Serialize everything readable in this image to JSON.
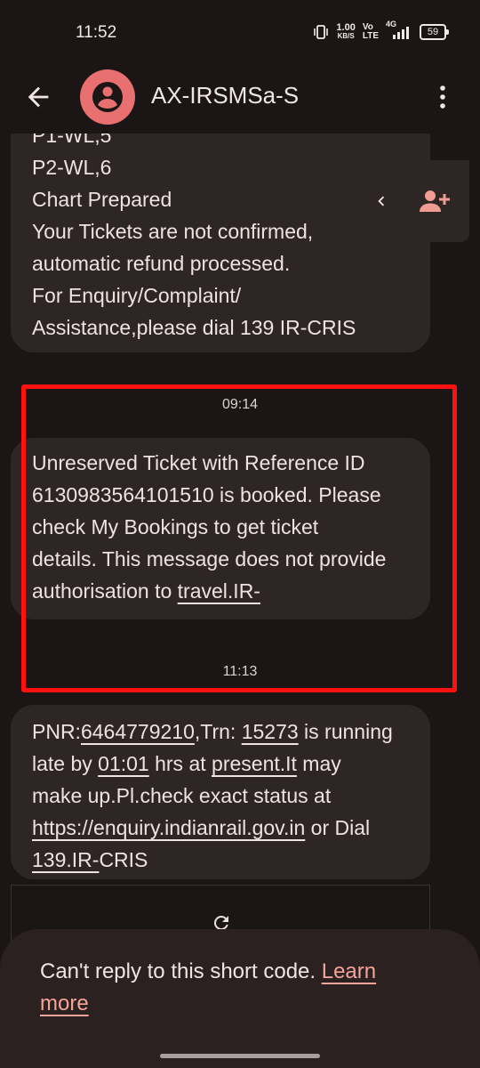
{
  "status": {
    "time": "11:52",
    "speed_value": "1.00",
    "speed_unit": "KB/S",
    "volte_top": "Vo",
    "volte_bottom": "LTE",
    "network": "4G",
    "battery": "59"
  },
  "header": {
    "contact": "AX-IRSMSa-S",
    "back_icon": "arrow-back-icon",
    "avatar_icon": "person-icon",
    "more_icon": "more-vert-icon"
  },
  "messages": [
    {
      "lines": [
        "P1-WL,5",
        "P2-WL,6",
        "Chart Prepared",
        "Your Tickets are not confirmed,",
        "automatic refund processed.",
        "For Enquiry/Complaint/",
        "Assistance,please dial 139 IR-CRIS"
      ]
    },
    {
      "timestamp": "09:14",
      "lines": [
        "Unreserved Ticket with Reference ID",
        "6130983564101510 is booked. Please",
        "check My Bookings to get ticket",
        "details. This message does not provide"
      ],
      "last_prefix": "authorisation to ",
      "last_link": "travel.IR-"
    },
    {
      "timestamp": "11:13",
      "pnr_label": "PNR:",
      "pnr": "6464779210",
      "trn_label": ",Trn: ",
      "trn": "15273",
      "l1_tail": " is running",
      "l2_pre": "late by ",
      "delay": "01:01",
      "l2_mid": " hrs at ",
      "present": "present.It",
      "l2_tail": " may",
      "l3": "make up.Pl.check exact status at",
      "url": "https://enquiry.indianrail.gov.in",
      "l4_tail": " or Dial",
      "dial": "139.IR-",
      "l5_tail": "CRIS"
    }
  ],
  "quick_actions": {
    "chevron_icon": "chevron-left-icon",
    "add_contact_icon": "person-add-icon"
  },
  "footer": {
    "text": "Can't reply to this short code. ",
    "learn_more": "Learn more"
  },
  "colors": {
    "background": "#1b1515",
    "bubble": "#2e2625",
    "avatar": "#e87070",
    "highlight": "#ff1111",
    "link": "#f5a49a"
  }
}
